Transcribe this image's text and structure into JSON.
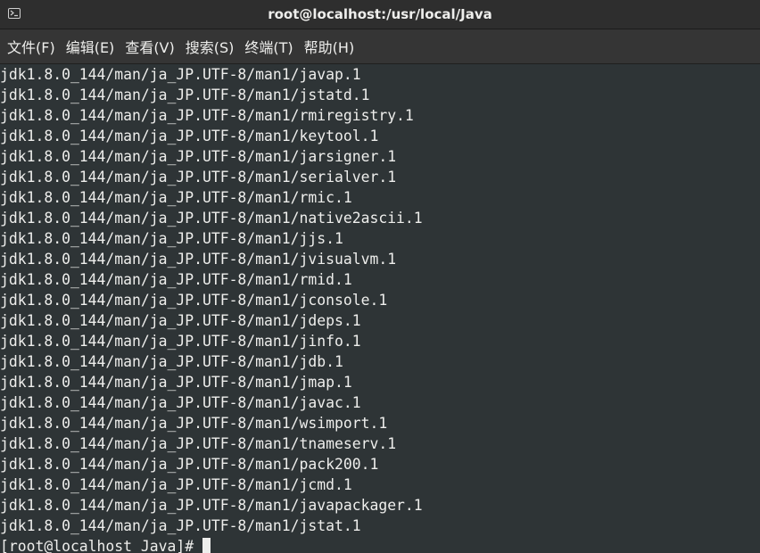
{
  "window": {
    "title": "root@localhost:/usr/local/Java",
    "icon": "terminal-icon"
  },
  "menu": [
    {
      "label": "文件(F)"
    },
    {
      "label": "编辑(E)"
    },
    {
      "label": "查看(V)"
    },
    {
      "label": "搜索(S)"
    },
    {
      "label": "终端(T)"
    },
    {
      "label": "帮助(H)"
    }
  ],
  "terminal": {
    "lines": [
      "jdk1.8.0_144/man/ja_JP.UTF-8/man1/javap.1",
      "jdk1.8.0_144/man/ja_JP.UTF-8/man1/jstatd.1",
      "jdk1.8.0_144/man/ja_JP.UTF-8/man1/rmiregistry.1",
      "jdk1.8.0_144/man/ja_JP.UTF-8/man1/keytool.1",
      "jdk1.8.0_144/man/ja_JP.UTF-8/man1/jarsigner.1",
      "jdk1.8.0_144/man/ja_JP.UTF-8/man1/serialver.1",
      "jdk1.8.0_144/man/ja_JP.UTF-8/man1/rmic.1",
      "jdk1.8.0_144/man/ja_JP.UTF-8/man1/native2ascii.1",
      "jdk1.8.0_144/man/ja_JP.UTF-8/man1/jjs.1",
      "jdk1.8.0_144/man/ja_JP.UTF-8/man1/jvisualvm.1",
      "jdk1.8.0_144/man/ja_JP.UTF-8/man1/rmid.1",
      "jdk1.8.0_144/man/ja_JP.UTF-8/man1/jconsole.1",
      "jdk1.8.0_144/man/ja_JP.UTF-8/man1/jdeps.1",
      "jdk1.8.0_144/man/ja_JP.UTF-8/man1/jinfo.1",
      "jdk1.8.0_144/man/ja_JP.UTF-8/man1/jdb.1",
      "jdk1.8.0_144/man/ja_JP.UTF-8/man1/jmap.1",
      "jdk1.8.0_144/man/ja_JP.UTF-8/man1/javac.1",
      "jdk1.8.0_144/man/ja_JP.UTF-8/man1/wsimport.1",
      "jdk1.8.0_144/man/ja_JP.UTF-8/man1/tnameserv.1",
      "jdk1.8.0_144/man/ja_JP.UTF-8/man1/pack200.1",
      "jdk1.8.0_144/man/ja_JP.UTF-8/man1/jcmd.1",
      "jdk1.8.0_144/man/ja_JP.UTF-8/man1/javapackager.1",
      "jdk1.8.0_144/man/ja_JP.UTF-8/man1/jstat.1"
    ],
    "prompt": "[root@localhost Java]#"
  }
}
